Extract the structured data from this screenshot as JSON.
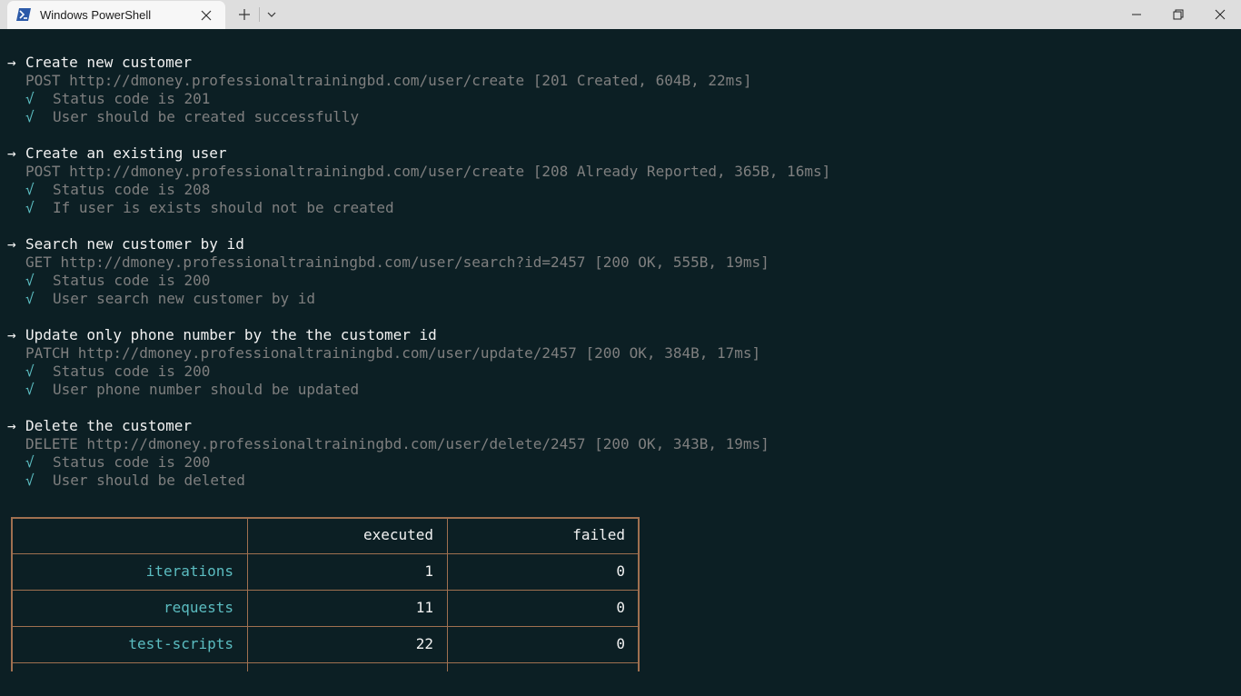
{
  "window": {
    "tab_title": "Windows PowerShell",
    "tab_icon": "powershell-icon",
    "new_tab_icon": "plus-icon",
    "dropdown_icon": "chevron-down-icon",
    "minimize_icon": "minimize-icon",
    "maximize_icon": "restore-icon",
    "close_icon": "close-icon"
  },
  "terminal": {
    "arrow": "→",
    "check": "√",
    "blocks": [
      {
        "title": "Create new customer",
        "request": "POST http://dmoney.professionaltrainingbd.com/user/create [201 Created, 604B, 22ms]",
        "tests": [
          "Status code is 201",
          "User should be created successfully"
        ]
      },
      {
        "title": "Create an existing user",
        "request": "POST http://dmoney.professionaltrainingbd.com/user/create [208 Already Reported, 365B, 16ms]",
        "tests": [
          "Status code is 208",
          "If user is exists should not be created"
        ]
      },
      {
        "title": "Search new customer by id",
        "request": "GET http://dmoney.professionaltrainingbd.com/user/search?id=2457 [200 OK, 555B, 19ms]",
        "tests": [
          "Status code is 200",
          "User search new customer by id"
        ]
      },
      {
        "title": "Update only phone number by the the customer id",
        "request": "PATCH http://dmoney.professionaltrainingbd.com/user/update/2457 [200 OK, 384B, 17ms]",
        "tests": [
          "Status code is 200",
          "User phone number should be updated"
        ]
      },
      {
        "title": "Delete the customer",
        "request": "DELETE http://dmoney.professionaltrainingbd.com/user/delete/2457 [200 OK, 343B, 19ms]",
        "tests": [
          "Status code is 200",
          "User should be deleted"
        ]
      }
    ]
  },
  "summary": {
    "headers": [
      "",
      "executed",
      "failed"
    ],
    "rows": [
      {
        "label": "iterations",
        "executed": "1",
        "failed": "0"
      },
      {
        "label": "requests",
        "executed": "11",
        "failed": "0"
      },
      {
        "label": "test-scripts",
        "executed": "22",
        "failed": "0"
      }
    ]
  },
  "colors": {
    "background": "#0c1f24",
    "text": "#f2f2f2",
    "request": "#7f7f7f",
    "check": "#5bbcc0",
    "table_border": "#a07050"
  }
}
